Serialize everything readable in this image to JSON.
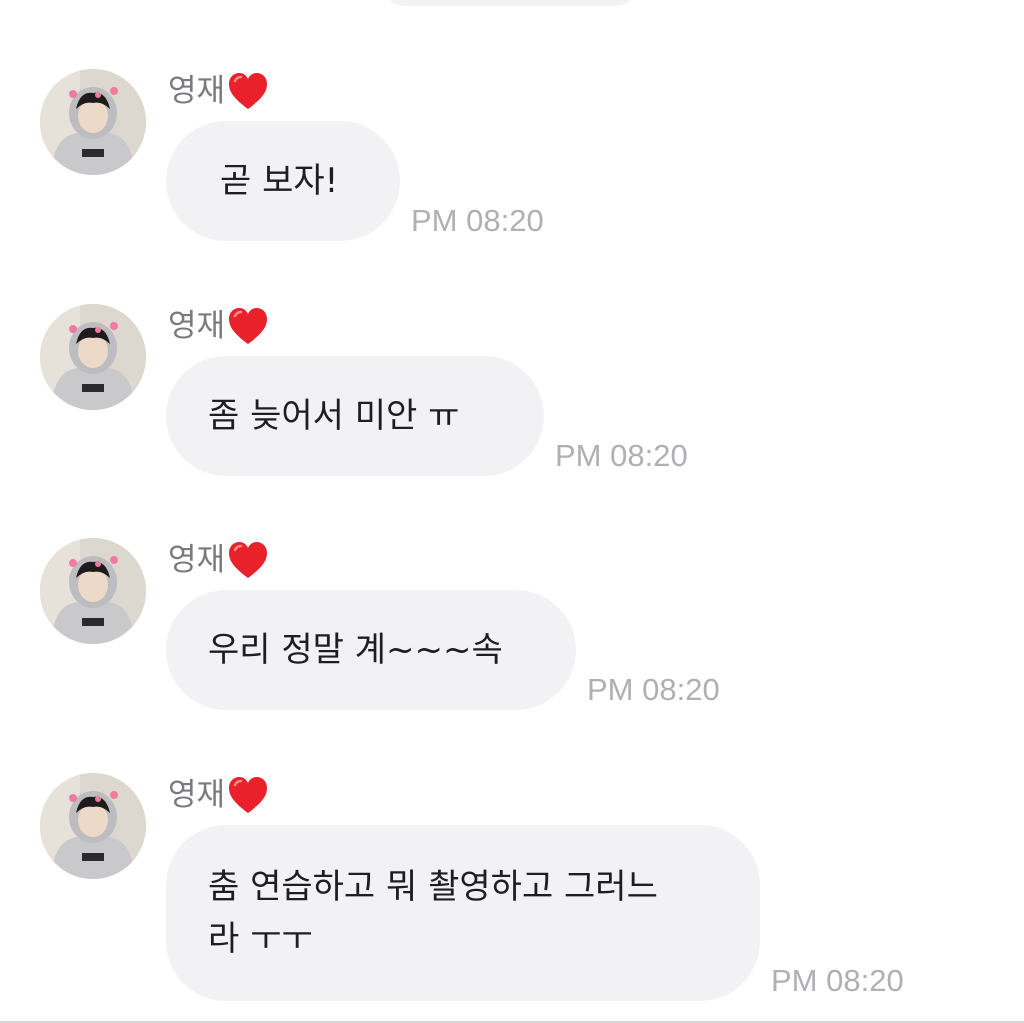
{
  "chat": {
    "icons": {
      "avatar": "avatar-photo",
      "heart": "red-heart-emoji"
    },
    "colors": {
      "bubble": "#f2f2f4",
      "timestamp": "#b0b0b4",
      "sender": "#7a7a7e",
      "heart": "#e8212b"
    },
    "messages": [
      {
        "sender": "영재",
        "text": "곧 보자!",
        "time": "PM 08:20"
      },
      {
        "sender": "영재",
        "text": "좀 늦어서 미안 ㅠ",
        "time": "PM 08:20"
      },
      {
        "sender": "영재",
        "text": "우리 정말 계~~~속",
        "time": "PM 08:20"
      },
      {
        "sender": "영재",
        "text": "춤 연습하고 뭐 촬영하고 그러느\n라 ㅜㅜ",
        "time": "PM 08:20"
      }
    ]
  }
}
